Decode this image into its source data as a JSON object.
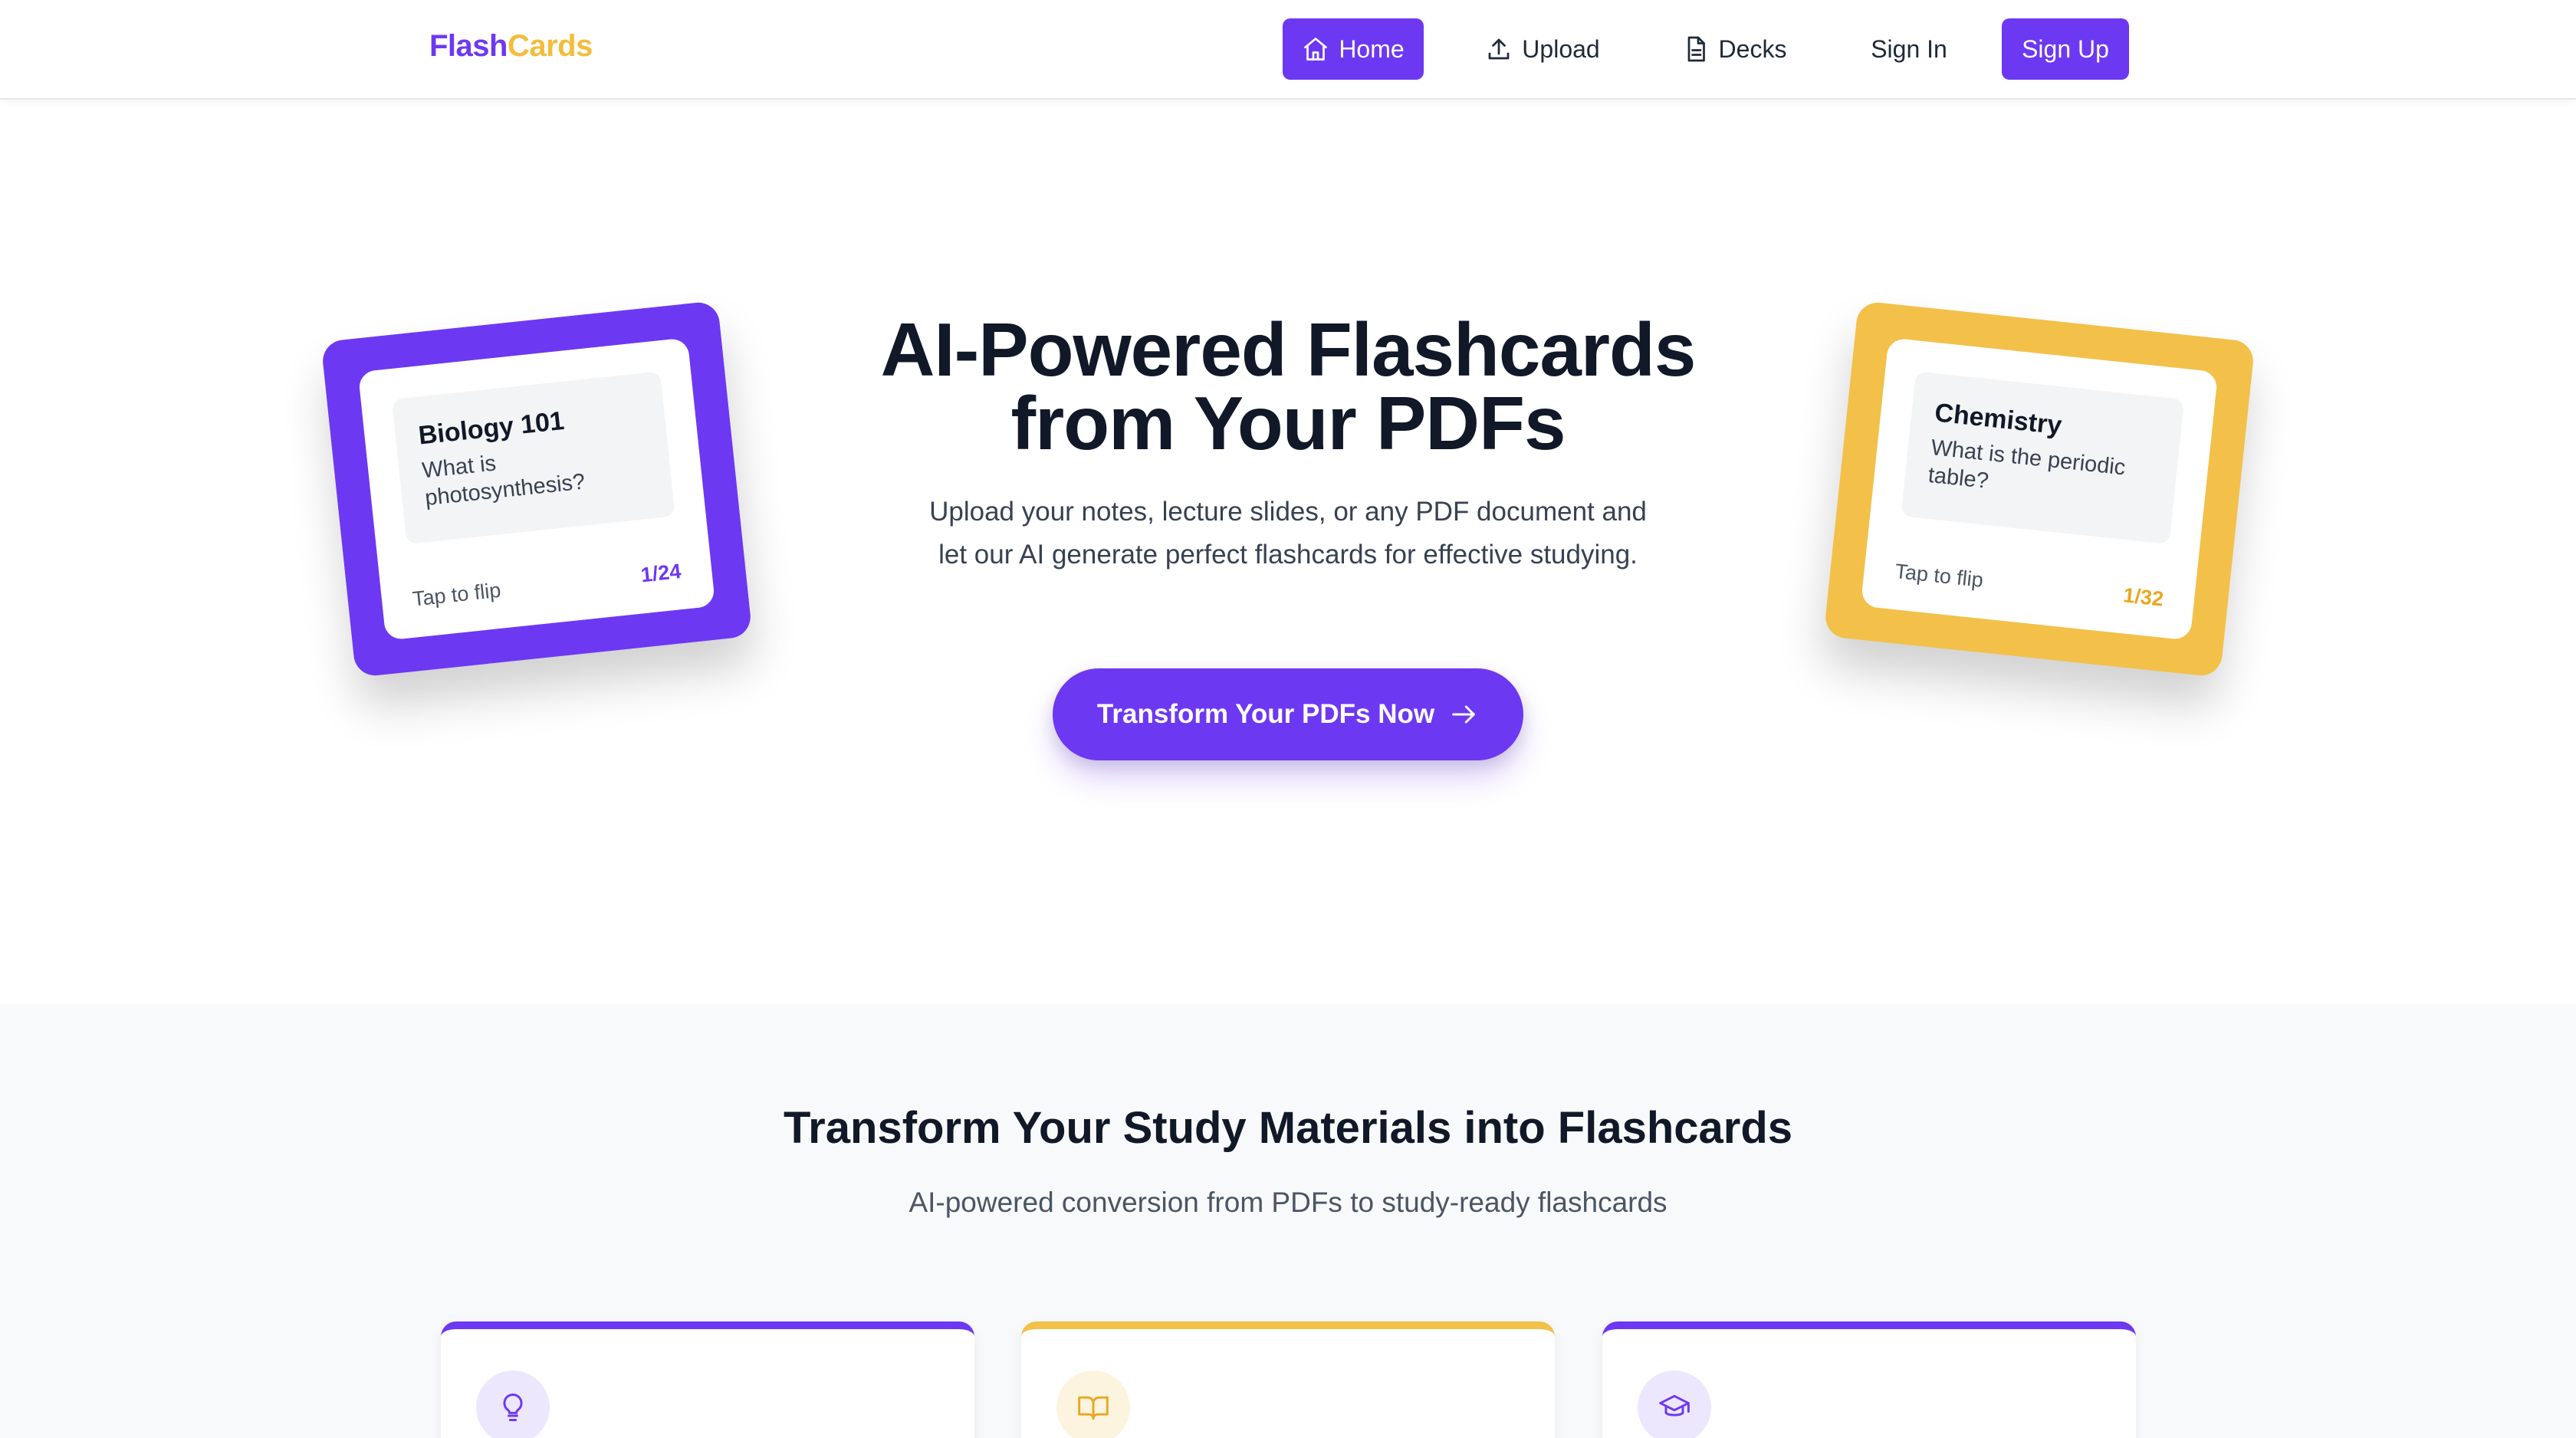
{
  "brand": {
    "part1": "Flash",
    "part2": "Cards"
  },
  "nav": {
    "home": "Home",
    "upload": "Upload",
    "decks": "Decks",
    "sign_in": "Sign In",
    "sign_up": "Sign Up"
  },
  "hero": {
    "title_line1": "AI-Powered Flashcards",
    "title_line2": "from Your PDFs",
    "subtitle": "Upload your notes, lecture slides, or any PDF document and let our AI generate perfect flashcards for effective studying.",
    "cta": "Transform Your PDFs Now"
  },
  "cards": [
    {
      "subject": "Biology 101",
      "question": "What is photosynthesis?",
      "hint": "Tap to flip",
      "counter": "1/24"
    },
    {
      "subject": "Chemistry",
      "question": "What is the periodic table?",
      "hint": "Tap to flip",
      "counter": "1/32"
    }
  ],
  "features": {
    "title": "Transform Your Study Materials into Flashcards",
    "subtitle": "AI-powered conversion from PDFs to study-ready flashcards",
    "items": [
      {
        "icon": "lightbulb-icon"
      },
      {
        "icon": "open-book-icon"
      },
      {
        "icon": "graduation-cap-icon"
      }
    ]
  },
  "colors": {
    "primary": "#6d38f2",
    "accent": "#f3c04a",
    "text": "#111827"
  }
}
